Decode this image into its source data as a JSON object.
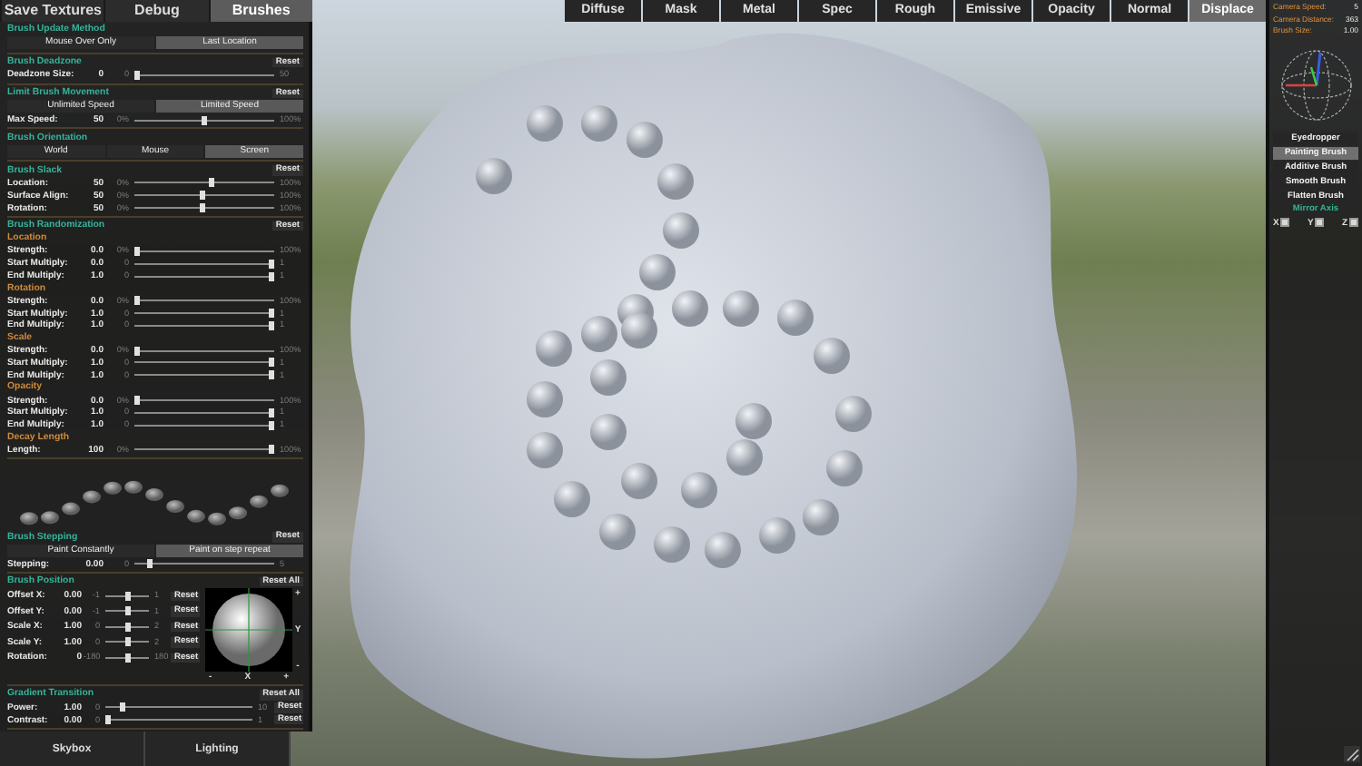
{
  "top_tabs": [
    {
      "label": "Save Textures",
      "selected": false
    },
    {
      "label": "Debug",
      "selected": false
    },
    {
      "label": "Brushes",
      "selected": true
    }
  ],
  "panel": {
    "sections": [
      {
        "kind": "controls",
        "title": "Brush Update Method",
        "rows": [
          {
            "kind": "toggle",
            "options": [
              {
                "label": "Mouse Over Only",
                "selected": false
              },
              {
                "label": "Last Location",
                "selected": true
              }
            ]
          }
        ]
      },
      {
        "kind": "controls",
        "title": "Brush Deadzone",
        "reset": "Reset",
        "rows": [
          {
            "kind": "slider",
            "label": "Deadzone Size:",
            "value": "0",
            "min": "0",
            "max": "50",
            "level": 0
          }
        ]
      },
      {
        "kind": "controls",
        "title": "Limit Brush Movement",
        "reset": "Reset",
        "rows": [
          {
            "kind": "toggle",
            "options": [
              {
                "label": "Unlimited Speed",
                "selected": false
              },
              {
                "label": "Limited Speed",
                "selected": true
              }
            ]
          },
          {
            "kind": "slider",
            "label": "Max Speed:",
            "value": "50",
            "min": "0%",
            "max": "100%",
            "level": 0.5
          }
        ]
      },
      {
        "kind": "controls",
        "title": "Brush Orientation",
        "rows": [
          {
            "kind": "toggle",
            "options": [
              {
                "label": "World",
                "selected": false
              },
              {
                "label": "Mouse",
                "selected": false
              },
              {
                "label": "Screen",
                "selected": true
              }
            ]
          }
        ]
      },
      {
        "kind": "controls",
        "title": "Brush Slack",
        "reset": "Reset",
        "rows": [
          {
            "kind": "slider",
            "label": "Location:",
            "value": "50",
            "min": "0%",
            "max": "100%",
            "level": 0.55
          },
          {
            "kind": "slider",
            "label": "Surface Align:",
            "value": "50",
            "min": "0%",
            "max": "100%",
            "level": 0.48
          },
          {
            "kind": "slider",
            "label": "Rotation:",
            "value": "50",
            "min": "0%",
            "max": "100%",
            "level": 0.48
          }
        ]
      },
      {
        "kind": "controls",
        "title": "Brush Randomization",
        "reset": "Reset",
        "rows": [
          {
            "kind": "subheading",
            "label": "Location"
          },
          {
            "kind": "slider",
            "label": "Strength:",
            "value": "0.0",
            "min": "0%",
            "max": "100%",
            "level": 0
          },
          {
            "kind": "slider",
            "label": "Start Multiply:",
            "value": "0.0",
            "min": "0",
            "max": "1",
            "level": 1
          },
          {
            "kind": "slider",
            "label": "End Multiply:",
            "value": "1.0",
            "min": "0",
            "max": "1",
            "level": 1
          },
          {
            "kind": "subheading",
            "label": "Rotation"
          },
          {
            "kind": "slider",
            "label": "Strength:",
            "value": "0.0",
            "min": "0%",
            "max": "100%",
            "level": 0
          },
          {
            "kind": "slider",
            "label": "Start Multiply:",
            "value": "1.0",
            "min": "0",
            "max": "1",
            "level": 1
          },
          {
            "kind": "slider",
            "label": "End Multiply:",
            "value": "1.0",
            "min": "0",
            "max": "1",
            "level": 1
          },
          {
            "kind": "subheading",
            "label": "Scale"
          },
          {
            "kind": "slider",
            "label": "Strength:",
            "value": "0.0",
            "min": "0%",
            "max": "100%",
            "level": 0
          },
          {
            "kind": "slider",
            "label": "Start Multiply:",
            "value": "1.0",
            "min": "0",
            "max": "1",
            "level": 1
          },
          {
            "kind": "slider",
            "label": "End Multiply:",
            "value": "1.0",
            "min": "0",
            "max": "1",
            "level": 1
          },
          {
            "kind": "subheading",
            "label": "Opacity"
          },
          {
            "kind": "slider",
            "label": "Strength:",
            "value": "0.0",
            "min": "0%",
            "max": "100%",
            "level": 0
          },
          {
            "kind": "slider",
            "label": "Start Multiply:",
            "value": "1.0",
            "min": "0",
            "max": "1",
            "level": 1
          },
          {
            "kind": "slider",
            "label": "End Multiply:",
            "value": "1.0",
            "min": "0",
            "max": "1",
            "level": 1
          },
          {
            "kind": "subheading",
            "label": "Decay Length"
          },
          {
            "kind": "slider",
            "label": "Length:",
            "value": "100",
            "min": "0%",
            "max": "100%",
            "level": 1
          }
        ]
      },
      {
        "kind": "preview"
      },
      {
        "kind": "controls",
        "title": "Brush Stepping",
        "reset": "Reset",
        "rows": [
          {
            "kind": "toggle",
            "options": [
              {
                "label": "Paint Constantly",
                "selected": false
              },
              {
                "label": "Paint on step repeat",
                "selected": true
              }
            ]
          },
          {
            "kind": "slider",
            "label": "Stepping:",
            "value": "0.00",
            "min": "0",
            "max": "5",
            "level": 0.1
          }
        ]
      },
      {
        "kind": "position",
        "title": "Brush Position",
        "reset": "Reset All",
        "rows": [
          {
            "kind": "slider",
            "label": "Offset X:",
            "value": "0.00",
            "min": "-1",
            "max": "1",
            "level": 0.5,
            "reset": "Reset"
          },
          {
            "kind": "slider",
            "label": "Offset Y:",
            "value": "0.00",
            "min": "-1",
            "max": "1",
            "level": 0.5,
            "reset": "Reset"
          },
          {
            "kind": "slider",
            "label": "Scale X:",
            "value": "1.00",
            "min": "0",
            "max": "2",
            "level": 0.5,
            "reset": "Reset"
          },
          {
            "kind": "slider",
            "label": "Scale Y:",
            "value": "1.00",
            "min": "0",
            "max": "2",
            "level": 0.5,
            "reset": "Reset"
          },
          {
            "kind": "slider",
            "label": "Rotation:",
            "value": "0",
            "min": "-180",
            "max": "180",
            "level": 0.5,
            "reset": "Reset"
          }
        ],
        "pad": {
          "y_axis": [
            "+",
            "Y",
            "-"
          ],
          "x_axis": [
            "-",
            "X",
            "+"
          ]
        }
      },
      {
        "kind": "controls",
        "title": "Gradient Transition",
        "reset": "Reset All",
        "rows": [
          {
            "kind": "slider",
            "label": "Power:",
            "value": "1.00",
            "min": "0",
            "max": "10",
            "level": 0.1,
            "reset": "Reset"
          },
          {
            "kind": "slider",
            "label": "Contrast:",
            "value": "0.00",
            "min": "0",
            "max": "1",
            "level": 0,
            "reset": "Reset"
          }
        ]
      }
    ]
  },
  "bottom_tabs": [
    {
      "label": "Skybox",
      "selected": false
    },
    {
      "label": "Lighting",
      "selected": false
    }
  ],
  "channel_tabs": [
    {
      "label": "Diffuse",
      "selected": false
    },
    {
      "label": "Mask",
      "selected": false
    },
    {
      "label": "Metal",
      "selected": false
    },
    {
      "label": "Spec",
      "selected": false
    },
    {
      "label": "Rough",
      "selected": false
    },
    {
      "label": "Emissive",
      "selected": false
    },
    {
      "label": "Opacity",
      "selected": false
    },
    {
      "label": "Normal",
      "selected": false
    },
    {
      "label": "Displace",
      "selected": true
    }
  ],
  "stats": [
    {
      "label": "Camera Speed:",
      "value": "5"
    },
    {
      "label": "Camera Distance:",
      "value": "363"
    },
    {
      "label": "Brush Size:",
      "value": "1.00"
    }
  ],
  "tools": [
    {
      "label": "Eyedropper",
      "selected": false
    },
    {
      "label": "Painting Brush",
      "selected": true
    },
    {
      "label": "Additive Brush",
      "selected": false
    },
    {
      "label": "Smooth Brush",
      "selected": false
    },
    {
      "label": "Flatten Brush",
      "selected": false
    }
  ],
  "mirror_axis": {
    "title": "Mirror Axis",
    "axes": [
      {
        "label": "X",
        "checked": false
      },
      {
        "label": "Y",
        "checked": false
      },
      {
        "label": "Z",
        "checked": false
      }
    ]
  }
}
